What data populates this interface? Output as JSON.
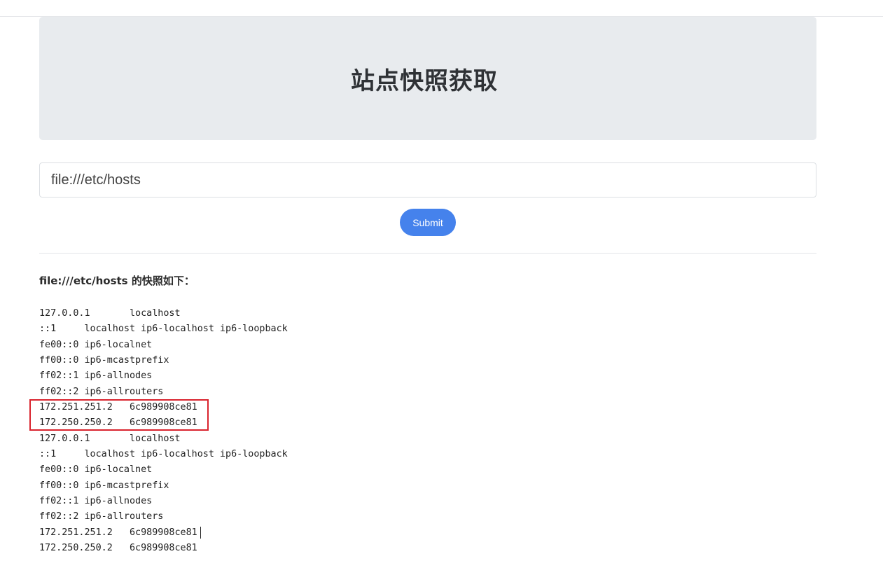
{
  "header": {
    "title": "站点快照获取"
  },
  "form": {
    "url_value": "file:///etc/hosts",
    "submit_label": "Submit"
  },
  "result": {
    "heading": "file:///etc/hosts 的快照如下：",
    "lines": [
      "127.0.0.1\tlocalhost",
      "::1\tlocalhost ip6-localhost ip6-loopback",
      "fe00::0 ip6-localnet",
      "ff00::0 ip6-mcastprefix",
      "ff02::1 ip6-allnodes",
      "ff02::2 ip6-allrouters",
      "172.251.251.2\t6c989908ce81",
      "172.250.250.2\t6c989908ce81",
      "127.0.0.1\tlocalhost",
      "::1\tlocalhost ip6-localhost ip6-loopback",
      "fe00::0 ip6-localnet",
      "ff00::0 ip6-mcastprefix",
      "ff02::1 ip6-allnodes",
      "ff02::2 ip6-allrouters",
      "172.251.251.2\t6c989908ce81",
      "172.250.250.2\t6c989908ce81"
    ]
  },
  "colors": {
    "accent": "#4582ec",
    "jumbotron_bg": "#e8ebee",
    "highlight": "#d9232d"
  }
}
